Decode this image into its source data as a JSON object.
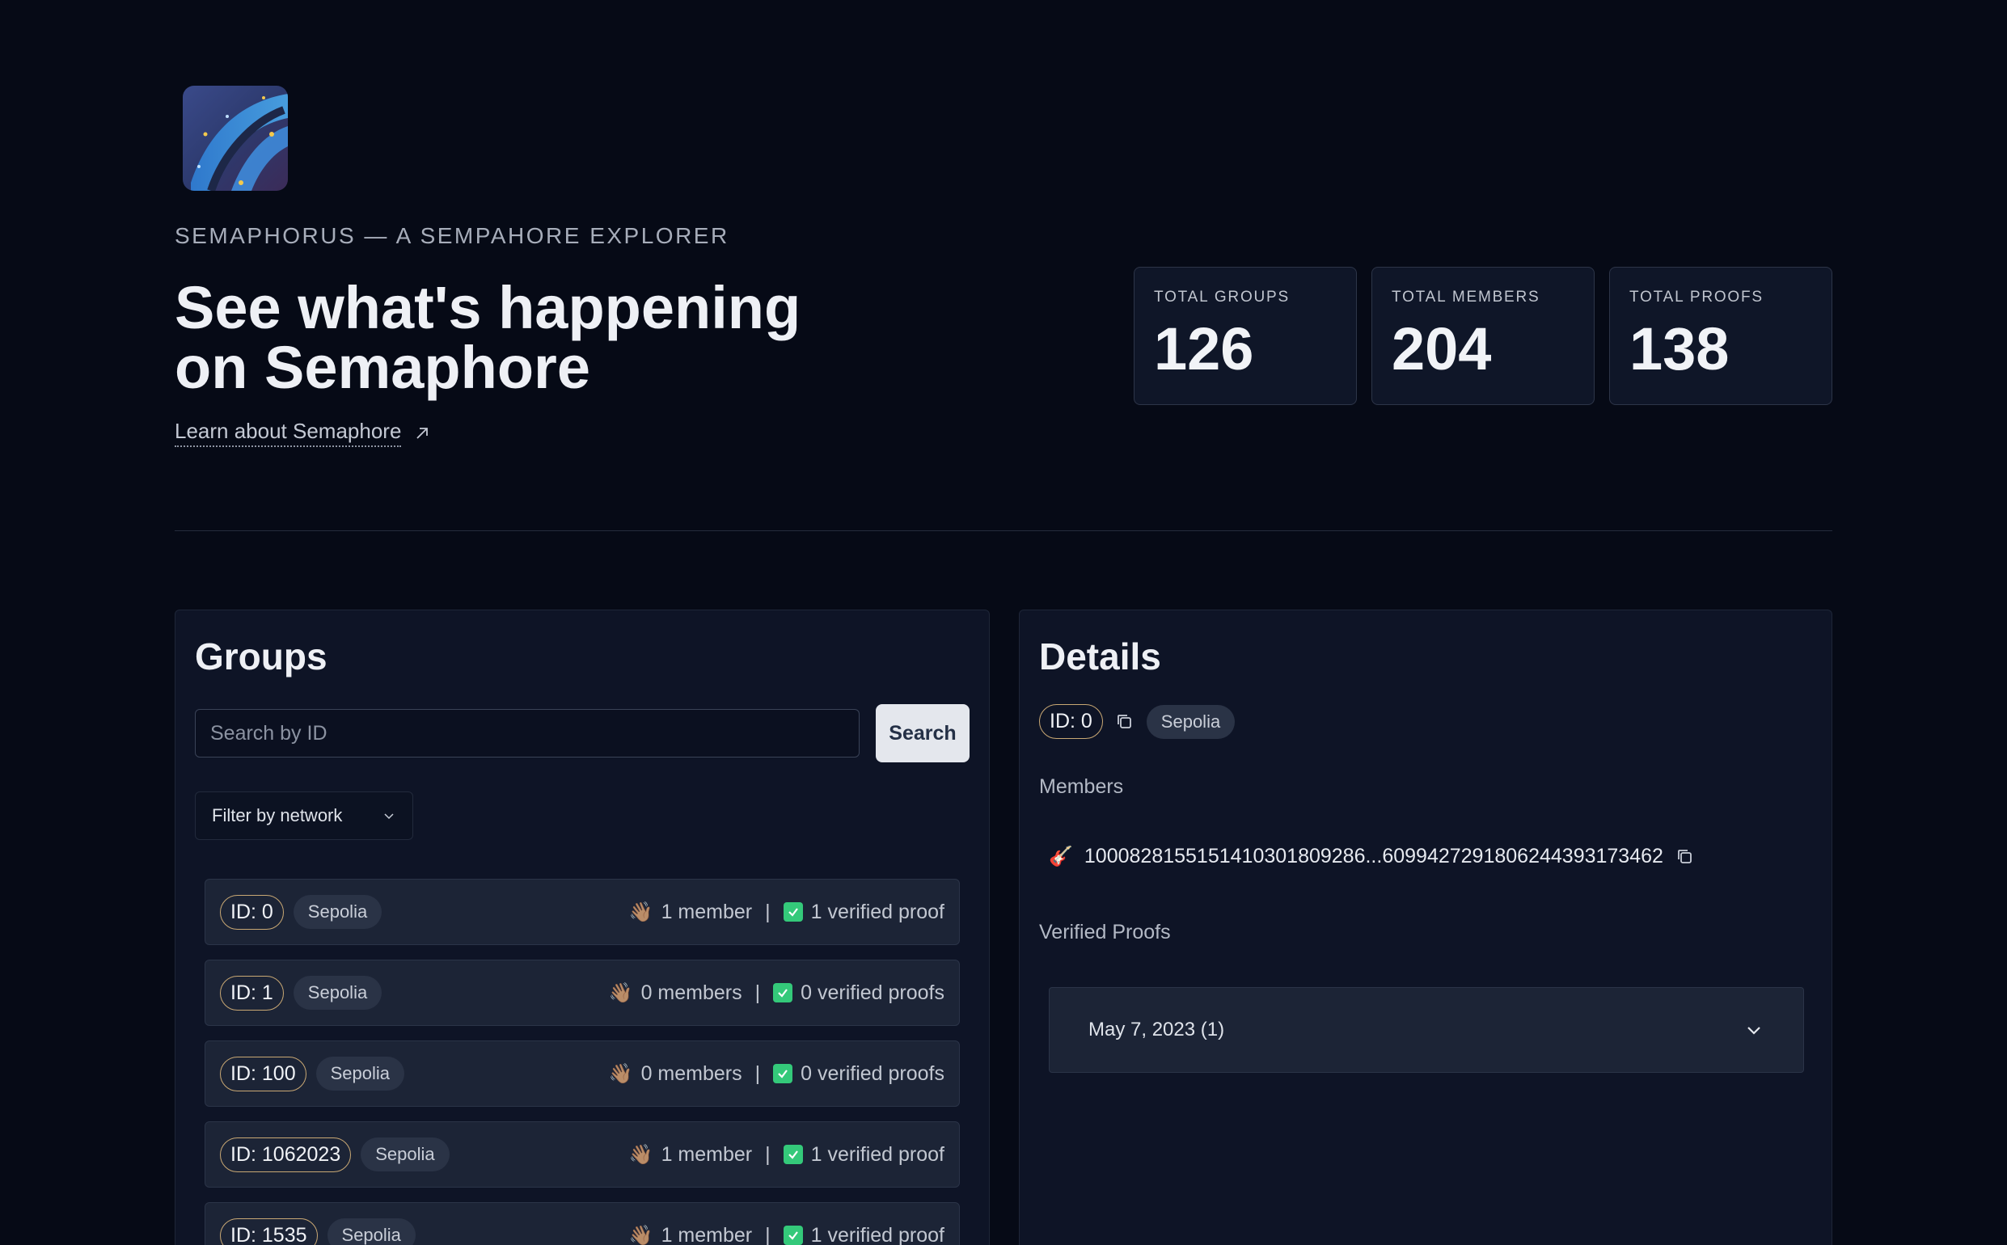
{
  "hero": {
    "kicker": "SEMAPHORUS — A SEMPAHORE EXPLORER",
    "headline_line1": "See what's happening",
    "headline_line2": "on Semaphore",
    "learn_link": "Learn about Semaphore",
    "logo_icon": "semaphorus-logo"
  },
  "stats": [
    {
      "label": "TOTAL GROUPS",
      "value": "126"
    },
    {
      "label": "TOTAL MEMBERS",
      "value": "204"
    },
    {
      "label": "TOTAL PROOFS",
      "value": "138"
    }
  ],
  "groups": {
    "title": "Groups",
    "search_placeholder": "Search by ID",
    "search_button": "Search",
    "filter_label": "Filter by network",
    "rows": [
      {
        "id": "ID: 0",
        "network": "Sepolia",
        "members": "1 member",
        "proofs": "1 verified proof"
      },
      {
        "id": "ID: 1",
        "network": "Sepolia",
        "members": "0 members",
        "proofs": "0 verified proofs"
      },
      {
        "id": "ID: 100",
        "network": "Sepolia",
        "members": "0 members",
        "proofs": "0 verified proofs"
      },
      {
        "id": "ID: 1062023",
        "network": "Sepolia",
        "members": "1 member",
        "proofs": "1 verified proof"
      },
      {
        "id": "ID: 1535",
        "network": "Sepolia",
        "members": "1 member",
        "proofs": "1 verified proof"
      }
    ],
    "members_emoji": "👋🏽",
    "separator": "|"
  },
  "details": {
    "title": "Details",
    "id": "ID: 0",
    "network": "Sepolia",
    "members_label": "Members",
    "member_emoji": "🎸",
    "member_value": "10008281551514103018092​86...6099427291806244393173462",
    "proofs_label": "Verified Proofs",
    "proof_date": "May 7, 2023 (1)"
  },
  "colors": {
    "background": "#060a16",
    "panel": "#0e1426",
    "row": "#1c2436",
    "id_pill_border": "#c9a874",
    "check_green": "#34c97a"
  }
}
